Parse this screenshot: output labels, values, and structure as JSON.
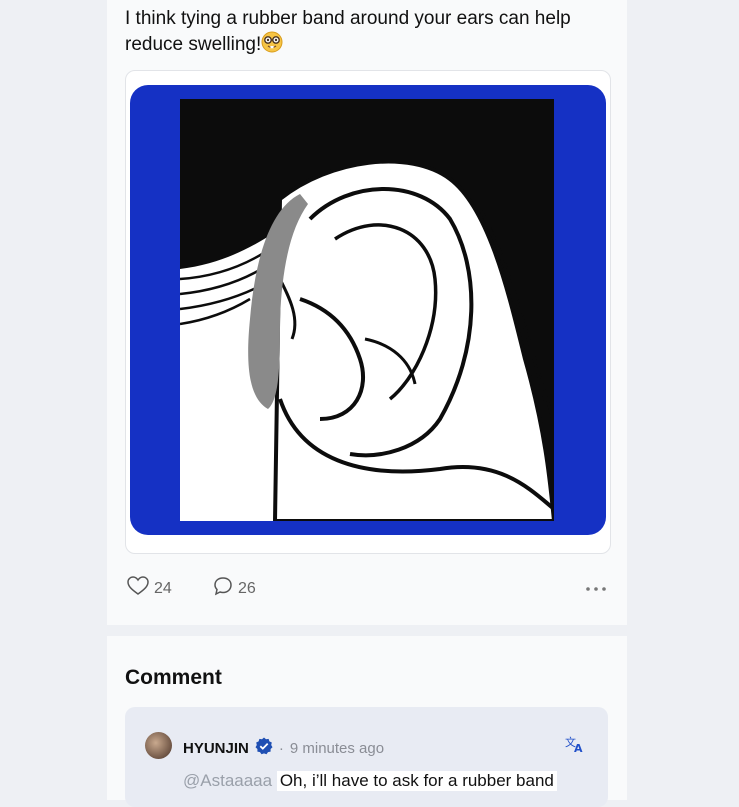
{
  "post": {
    "text": "I think tying a rubber band around your ears can help reduce swelling!",
    "emoji_icon": "nerd-face-emoji",
    "image_colors": {
      "frame": "#1531c4",
      "background": "#0c0c0c",
      "band": "#8a8a8a"
    }
  },
  "actions": {
    "like_count": "24",
    "comment_count": "26",
    "more_icon": "more-dots-icon"
  },
  "comments": {
    "heading": "Comment",
    "items": [
      {
        "username": "HYUNJIN",
        "verified_icon": "verified-badge-icon",
        "separator": "·",
        "time": "9 minutes ago",
        "mention": "@Astaaaaa",
        "caption": "Oh, i’ll have to ask for a rubber band"
      }
    ]
  }
}
